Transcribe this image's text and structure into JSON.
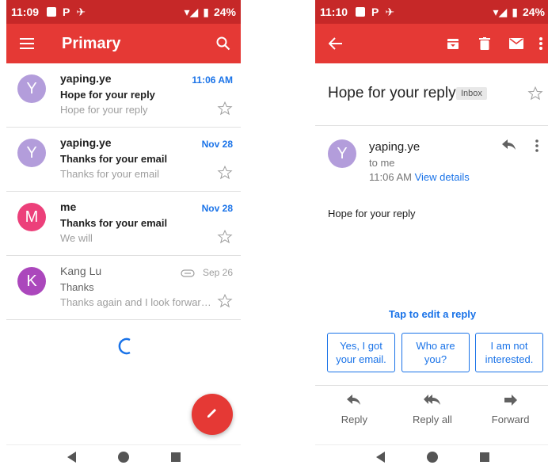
{
  "left": {
    "status": {
      "time": "11:09",
      "battery": "24%"
    },
    "appbar": {
      "title": "Primary"
    },
    "emails": [
      {
        "initial": "Y",
        "avatar_color": "#b39ddb",
        "sender": "yaping.ye",
        "subject": "Hope for your reply",
        "snippet": "Hope for your reply",
        "date": "11:06 AM",
        "unread": true,
        "attachment": false
      },
      {
        "initial": "Y",
        "avatar_color": "#b39ddb",
        "sender": "yaping.ye",
        "subject": "Thanks for your email",
        "snippet": "Thanks for your email",
        "date": "Nov 28",
        "unread": true,
        "attachment": false
      },
      {
        "initial": "M",
        "avatar_color": "#ec407a",
        "sender": "me",
        "subject": "Thanks for your email",
        "snippet": "We will",
        "date": "Nov 28",
        "unread": true,
        "attachment": false
      },
      {
        "initial": "K",
        "avatar_color": "#ab47bc",
        "sender": "Kang Lu",
        "subject": "Thanks",
        "snippet": "Thanks again and I look forward to hearing from you",
        "date": "Sep 26",
        "unread": false,
        "attachment": true
      }
    ],
    "icons": {
      "menu": "menu-icon",
      "search": "search-icon",
      "compose": "pencil-icon",
      "spinner": "loading-spinner"
    }
  },
  "right": {
    "status": {
      "time": "11:10",
      "battery": "24%"
    },
    "toolbar_icons": [
      "back-arrow-icon",
      "archive-icon",
      "delete-icon",
      "mail-icon",
      "more-vert-icon"
    ],
    "subject": "Hope for your reply",
    "label_chip": "Inbox",
    "message": {
      "initial": "Y",
      "sender": "yaping.ye",
      "to": "to me",
      "time": "11:06 AM",
      "details_link": "View details",
      "body": "Hope for your reply"
    },
    "tap_to_edit": "Tap to edit a reply",
    "smart_replies": [
      {
        "line1": "Yes, I got",
        "line2": "your email."
      },
      {
        "line1": "Who are",
        "line2": "you?"
      },
      {
        "line1": "I am not",
        "line2": "interested."
      }
    ],
    "actions": {
      "reply": "Reply",
      "reply_all": "Reply all",
      "forward": "Forward"
    }
  },
  "colors": {
    "appbar": "#e53935",
    "statusbar": "#c62828",
    "accent": "#1a73e8"
  }
}
